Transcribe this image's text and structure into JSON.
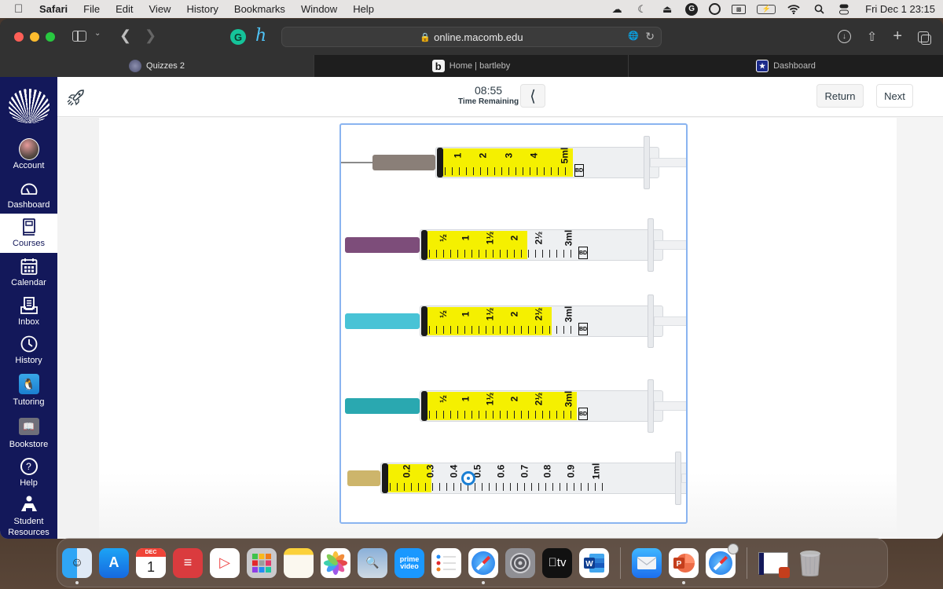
{
  "menubar": {
    "app_name": "Safari",
    "items": [
      "File",
      "Edit",
      "View",
      "History",
      "Bookmarks",
      "Window",
      "Help"
    ],
    "status_icons": [
      "creative-cloud-icon",
      "moon-icon",
      "eject-icon",
      "grammarly-icon",
      "user-circle-icon",
      "window-icon",
      "battery-charging-icon",
      "wifi-icon",
      "search-icon",
      "control-center-icon"
    ],
    "clock": "Fri Dec 1  23:15"
  },
  "browser": {
    "url": "online.macomb.edu",
    "tabs": [
      {
        "label": "Quizzes 2",
        "active": true
      },
      {
        "label": "Home | bartleby",
        "active": false
      },
      {
        "label": "Dashboard",
        "active": false
      }
    ],
    "extensions": [
      "grammarly",
      "honey"
    ]
  },
  "canvas_nav": {
    "items": [
      {
        "label": "Account",
        "icon": "avatar"
      },
      {
        "label": "Dashboard",
        "icon": "speedometer-icon"
      },
      {
        "label": "Courses",
        "icon": "book-icon",
        "active": true
      },
      {
        "label": "Calendar",
        "icon": "calendar-icon"
      },
      {
        "label": "Inbox",
        "icon": "inbox-icon"
      },
      {
        "label": "History",
        "icon": "clock-icon"
      },
      {
        "label": "Tutoring",
        "icon": "penguin-icon"
      },
      {
        "label": "Bookstore",
        "icon": "bookstore-icon"
      },
      {
        "label": "Help",
        "icon": "question-icon"
      },
      {
        "label": "Student Resources",
        "icon": "student-resources-icon"
      }
    ]
  },
  "quiz": {
    "time": "08:55",
    "time_label": "Time Remaining",
    "return_label": "Return",
    "next_label": "Next"
  },
  "image": {
    "description": "Five syringes with yellow-filled barrels",
    "syringes": [
      {
        "scale": [
          "1",
          "2",
          "3",
          "4",
          "5ml"
        ],
        "fill_fraction": 1.0,
        "hub_color": "#8a7f78"
      },
      {
        "scale": [
          "½",
          "1",
          "1½",
          "2",
          "2½",
          "3ml"
        ],
        "fill_fraction": 0.67,
        "hub_color": "#7d4d7a"
      },
      {
        "scale": [
          "½",
          "1",
          "1½",
          "2",
          "2½",
          "3ml"
        ],
        "fill_fraction": 0.83,
        "hub_color": "#48c3d6"
      },
      {
        "scale": [
          "½",
          "1",
          "1½",
          "2",
          "2½",
          "3ml"
        ],
        "fill_fraction": 1.0,
        "hub_color": "#2aa8b0"
      },
      {
        "scale": [
          "0.2",
          "0.3",
          "0.4",
          "0.5",
          "0.6",
          "0.7",
          "0.8",
          "0.9",
          "1ml"
        ],
        "fill_fraction": 0.2,
        "hub_color": "#cdb56b"
      }
    ],
    "bd_label": "BD"
  },
  "dock": {
    "apps": [
      {
        "name": "Finder",
        "running": true
      },
      {
        "name": "App Store"
      },
      {
        "name": "Calendar",
        "month": "DEC",
        "day": "1"
      },
      {
        "name": "ExpressVPN"
      },
      {
        "name": "Infuse"
      },
      {
        "name": "Launchpad"
      },
      {
        "name": "Notes"
      },
      {
        "name": "Photos"
      },
      {
        "name": "Preview"
      },
      {
        "name": "Prime Video",
        "label": "prime video"
      },
      {
        "name": "Reminders"
      },
      {
        "name": "Safari",
        "running": true
      },
      {
        "name": "System Settings"
      },
      {
        "name": "Apple TV",
        "label": "tv"
      },
      {
        "name": "Microsoft Word"
      },
      {
        "name": "Mail"
      },
      {
        "name": "Microsoft PowerPoint",
        "running": true
      },
      {
        "name": "Safari (iPhone)"
      },
      {
        "name": "PowerPoint Window"
      },
      {
        "name": "Trash"
      }
    ]
  }
}
